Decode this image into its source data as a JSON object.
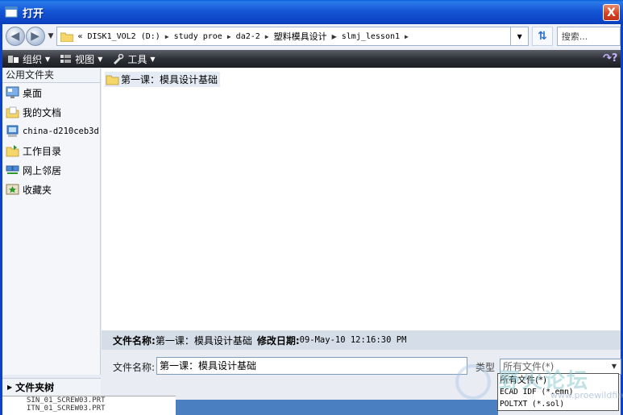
{
  "window": {
    "title": "打开",
    "close_label": "X"
  },
  "address": {
    "prefix": "«",
    "crumbs": [
      "DISK1_VOL2 (D:)",
      "study proe",
      "da2-2",
      "塑料模具设计",
      "slmj_lesson1"
    ]
  },
  "search": {
    "placeholder": "搜索..."
  },
  "toolbar": {
    "organize": "组织",
    "views": "视图",
    "tools": "工具"
  },
  "sidebar": {
    "header": "公用文件夹",
    "items": [
      {
        "label": "桌面",
        "icon": "desktop-icon"
      },
      {
        "label": "我的文档",
        "icon": "my-documents-icon"
      },
      {
        "label": "china-d210ceb3d",
        "icon": "computer-icon"
      },
      {
        "label": "工作目录",
        "icon": "working-directory-icon"
      },
      {
        "label": "网上邻居",
        "icon": "network-icon"
      },
      {
        "label": "收藏夹",
        "icon": "favorites-icon"
      }
    ],
    "folders_tree": "文件夹树"
  },
  "files": [
    {
      "name": "第一课：模具设计基础",
      "icon": "folder-icon"
    }
  ],
  "details": {
    "name_label": "文件名称:",
    "name_value": "第一课：模具设计基础",
    "date_label": "修改日期:",
    "date_value": "09-May-10 12:16:30 PM"
  },
  "form": {
    "filename_label": "文件名称:",
    "filename_value": "第一课：模具设计基础",
    "type_label": "类型",
    "type_value": "所有文件(*)",
    "type_options": [
      "所有文件(*)",
      "ECAD IDF (*.emn)",
      "POLTXT (*.sol)"
    ]
  },
  "background_list": [
    "SIN_01_SCREW03.PRT",
    "ITN_01_SCREW03.PRT"
  ],
  "watermark": {
    "big": "野火论坛",
    "small": "www.proewildfire.cn"
  },
  "colors": {
    "titlebar": "#0b43c4",
    "toolbar": "#2d3036",
    "selection": "#e4ebf5"
  }
}
